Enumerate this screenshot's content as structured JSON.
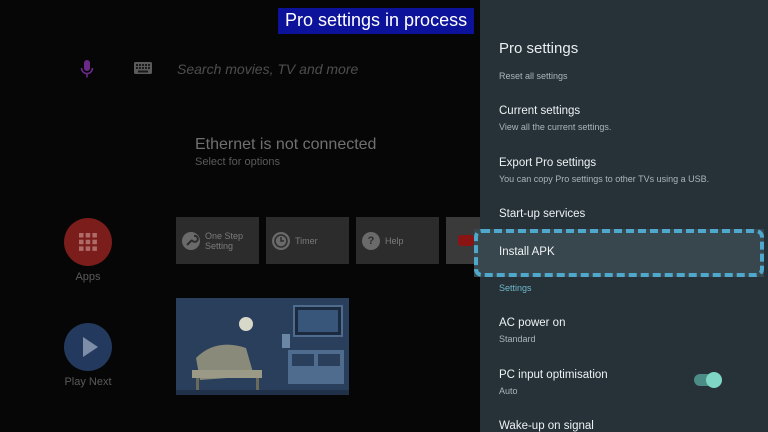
{
  "banner": {
    "text": "Pro settings in process"
  },
  "home": {
    "search_placeholder": "Search movies, TV and more",
    "network_title": "Ethernet is not connected",
    "network_subtitle": "Select for options",
    "apps_label": "Apps",
    "play_next_label": "Play Next",
    "tiles": [
      {
        "label_line1": "One Step",
        "label_line2": "Setting"
      },
      {
        "label": "Timer"
      },
      {
        "label": "Help"
      }
    ]
  },
  "panel": {
    "title": "Pro settings",
    "cut_item_desc": "Reset all settings",
    "items": [
      {
        "title": "Current settings",
        "desc": "View all the current settings."
      },
      {
        "title": "Export Pro settings",
        "desc": "You can copy Pro settings to other TVs using a USB."
      },
      {
        "title": "Start-up services"
      },
      {
        "title": "Install APK"
      },
      {
        "title": "AC power on",
        "desc": "Standard"
      },
      {
        "title": "PC input optimisation",
        "desc": "Auto"
      },
      {
        "title": "Wake-up on signal"
      }
    ],
    "section_header": "Settings",
    "pc_input_toggle_on": true
  },
  "colors": {
    "panel_bg": "#263238",
    "highlight": "#4fa8cc",
    "banner_bg": "#0c139a",
    "toggle_on": "#7fd6c6"
  }
}
